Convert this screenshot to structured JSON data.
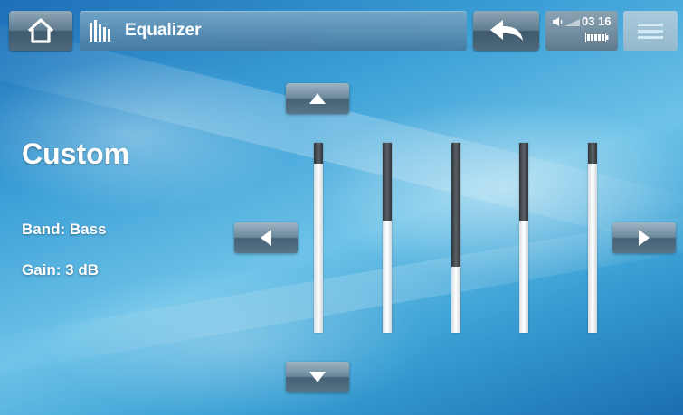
{
  "header": {
    "title": "Equalizer",
    "icons": {
      "home": "home-icon",
      "equalizer": "equalizer-icon",
      "back": "back-arrow-icon",
      "volume": "volume-icon",
      "battery": "battery-icon",
      "menu": "menu-icon"
    },
    "clock": "03 16"
  },
  "panel": {
    "preset_name": "Custom",
    "band_label": "Band: Bass",
    "gain_label": "Gain: 3 dB"
  },
  "equalizer": {
    "bands": [
      {
        "level": 0.89
      },
      {
        "level": 0.59
      },
      {
        "level": 0.35
      },
      {
        "level": 0.59
      },
      {
        "level": 0.89
      }
    ]
  },
  "colors": {
    "accent": "#5f7b8e",
    "track_fill": "#ffffff",
    "track_empty": "#3a4045"
  }
}
